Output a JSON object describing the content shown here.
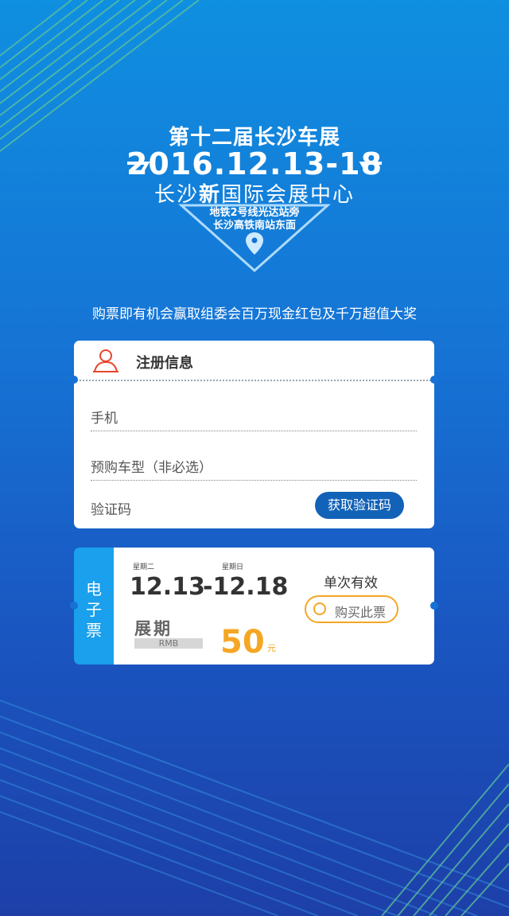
{
  "header": {
    "title": "第十二届长沙车展",
    "dates": "2016.12.13-18",
    "venue_prefix": "长沙",
    "venue_bold": "新",
    "venue_suffix": "国际会展中心",
    "address_line1": "地铁2号线光达站旁",
    "address_line2": "长沙高铁南站东面"
  },
  "promo": "购票即有机会赢取组委会百万现金红包及千万超值大奖",
  "registration": {
    "title": "注册信息",
    "phone_placeholder": "手机",
    "model_placeholder": "预购车型（非必选）",
    "code_label": "验证码",
    "get_code_button": "获取验证码"
  },
  "ticket": {
    "side_label": [
      "电",
      "子",
      "票"
    ],
    "start_weekday": "星期二",
    "end_weekday": "星期日",
    "start_date": "12.13",
    "end_date": "-12.18",
    "period_label": "展期",
    "currency": "RMB",
    "price": "50",
    "price_unit": "元",
    "validity": "单次有效",
    "buy_button": "购买此票"
  },
  "colors": {
    "accent": "#1262b8",
    "ticket_side": "#1aa0ec",
    "price": "#f5a623",
    "user_icon": "#e8462c",
    "stripes": "#7fd23a"
  },
  "icons": [
    "location-pin-icon",
    "user-icon",
    "radio-circle-icon"
  ]
}
